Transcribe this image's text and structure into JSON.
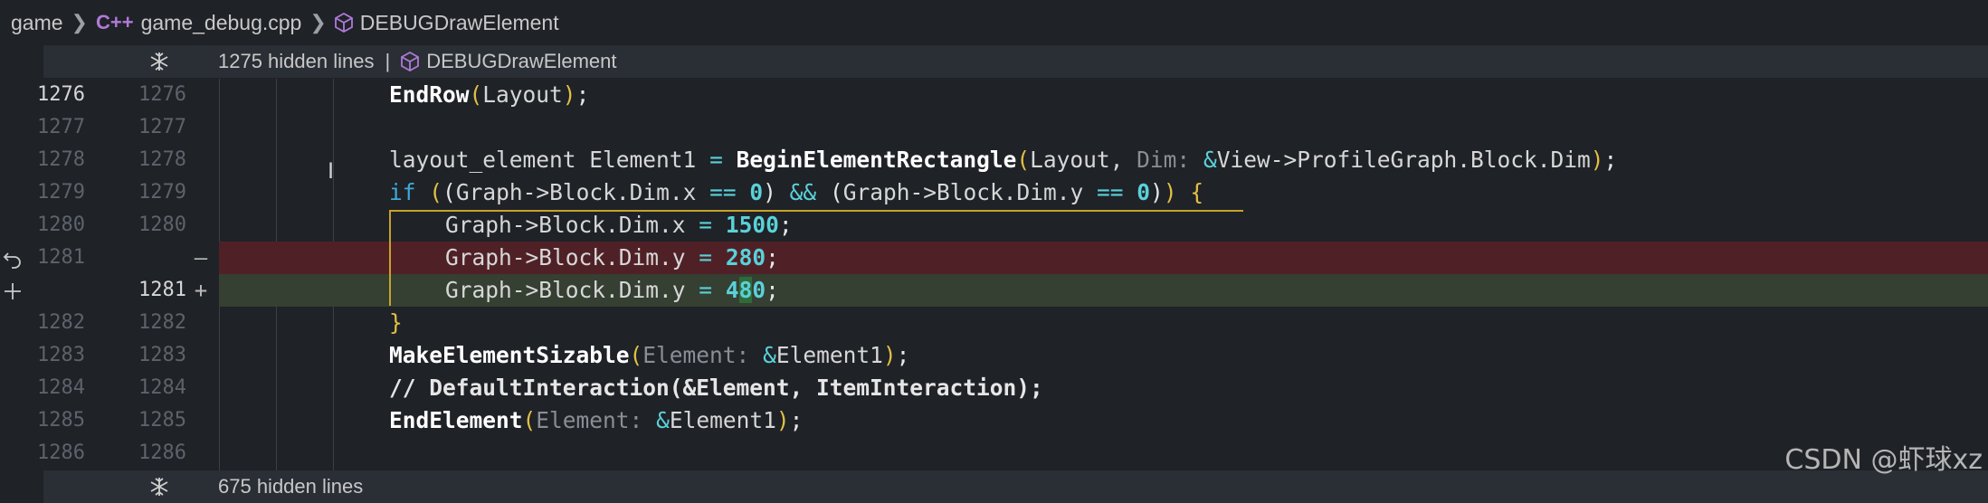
{
  "breadcrumb": {
    "root": "game",
    "file": "game_debug.cpp",
    "symbol": "DEBUGDrawElement",
    "file_icon": "cpp-file-icon",
    "symbol_icon": "cube-icon"
  },
  "hidden_top": {
    "count_label": "1275 hidden lines",
    "divider": "|",
    "symbol": "DEBUGDrawElement"
  },
  "hidden_bottom": {
    "count_label": "675 hidden lines"
  },
  "diff_markers": {
    "removed": "—",
    "added": "+"
  },
  "lines": [
    {
      "old": "1276",
      "new": "1276"
    },
    {
      "old": "1277",
      "new": "1277"
    },
    {
      "old": "1278",
      "new": "1278"
    },
    {
      "old": "1279",
      "new": "1279"
    },
    {
      "old": "1280",
      "new": "1280"
    },
    {
      "old": "1281",
      "new": ""
    },
    {
      "old": "",
      "new": "1281"
    },
    {
      "old": "1282",
      "new": "1282"
    },
    {
      "old": "1283",
      "new": "1283"
    },
    {
      "old": "1284",
      "new": "1284"
    },
    {
      "old": "1285",
      "new": "1285"
    },
    {
      "old": "1286",
      "new": "1286"
    }
  ],
  "code": {
    "l1": {
      "fn": "EndRow",
      "lp": "(",
      "arg": "Layout",
      "rp": ")",
      "semi": ";"
    },
    "l3": {
      "type": "layout_element",
      "var": "Element1",
      "eq": "=",
      "fn": "BeginElementRectangle",
      "lp": "(",
      "arg1": "Layout,",
      "hint": "Dim:",
      "amp": "&",
      "arg2": "View->ProfileGraph.Block.Dim",
      "rp": ")",
      "semi": ";"
    },
    "l4": {
      "kw": "if",
      "lp1": "(",
      "lp2": "(",
      "a": "Graph->Block.Dim.x",
      "eq1": "==",
      "n1": "0",
      "rp2": ")",
      "and": "&&",
      "lp3": "(",
      "b": "Graph->Block.Dim.y",
      "eq2": "==",
      "n2": "0",
      "rp3": ")",
      "rp1": ")",
      "brace": "{"
    },
    "l5": {
      "lhs": "Graph->Block.Dim.x",
      "eq": "=",
      "num": "1500",
      "semi": ";"
    },
    "l6": {
      "lhs": "Graph->Block.Dim.y",
      "eq": "=",
      "num": "280",
      "semi": ";"
    },
    "l7": {
      "lhs": "Graph->Block.Dim.y",
      "eq": "=",
      "num_a": "4",
      "num_b": "8",
      "num_c": "0",
      "semi": ";"
    },
    "l8": {
      "brace": "}"
    },
    "l9": {
      "fn": "MakeElementSizable",
      "lp": "(",
      "hint": "Element:",
      "amp": "&",
      "arg": "Element1",
      "rp": ")",
      "semi": ";"
    },
    "l10": {
      "comment": "// DefaultInteraction(&Element, ItemInteraction);"
    },
    "l11": {
      "fn": "EndElement",
      "lp": "(",
      "hint": "Element:",
      "amp": "&",
      "arg": "Element1",
      "rp": ")",
      "semi": ";"
    }
  },
  "watermark": "CSDN @虾球xz"
}
